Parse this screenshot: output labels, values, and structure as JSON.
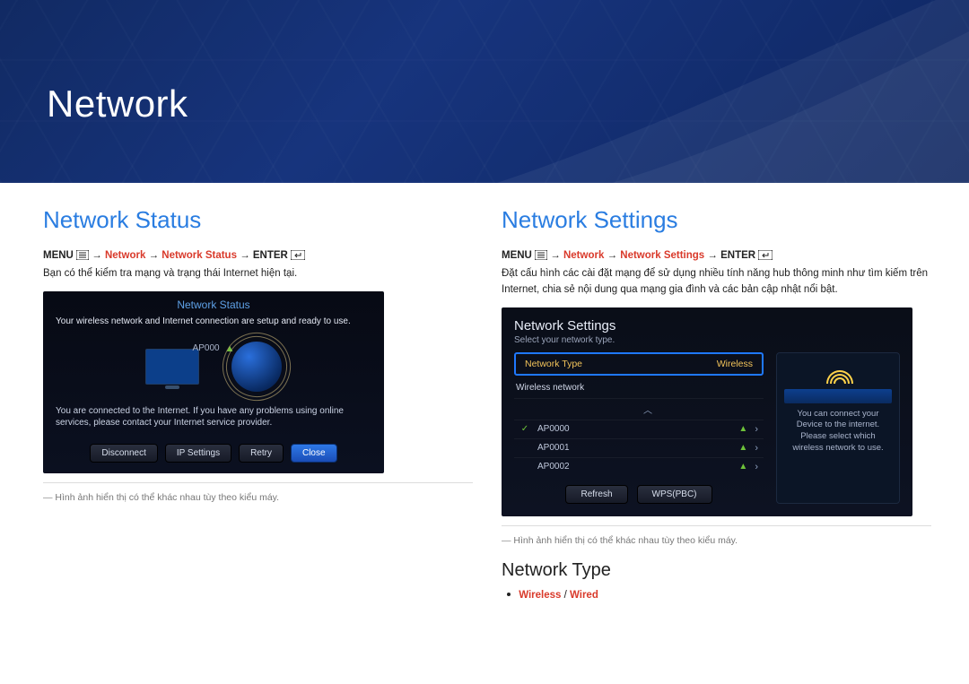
{
  "header": {
    "title": "Network"
  },
  "left": {
    "heading": "Network Status",
    "nav": {
      "menu": "MENU",
      "arrow": "→",
      "seg1": "Network",
      "seg2": "Network Status",
      "enter": "ENTER"
    },
    "desc": "Bạn có thể kiểm tra mạng và trạng thái Internet hiện tại.",
    "shot": {
      "title": "Network Status",
      "subtitle": "Your wireless network and Internet connection are setup and ready to use.",
      "ap": "AP000",
      "msg": "You are connected to the Internet. If you have any problems using online services, please contact your Internet service provider.",
      "btn_disconnect": "Disconnect",
      "btn_ip": "IP Settings",
      "btn_retry": "Retry",
      "btn_close": "Close"
    },
    "caption": "Hình ảnh hiển thị có thể khác nhau tùy theo kiểu máy."
  },
  "right": {
    "heading": "Network Settings",
    "nav": {
      "menu": "MENU",
      "seg1": "Network",
      "seg2": "Network Settings",
      "enter": "ENTER"
    },
    "desc": "Đặt cấu hình các cài đặt mạng để sử dụng nhiều tính năng hub thông minh như tìm kiếm trên Internet, chia sẻ nội dung qua mạng gia đình và các bản cập nhật nổi bật.",
    "shot": {
      "title": "Network Settings",
      "subtitle": "Select your network type.",
      "nt_key": "Network Type",
      "nt_val": "Wireless",
      "wnet": "Wireless network",
      "aps": [
        {
          "name": "AP0000",
          "checked": true
        },
        {
          "name": "AP0001",
          "checked": false
        },
        {
          "name": "AP0002",
          "checked": false
        }
      ],
      "btn_refresh": "Refresh",
      "btn_wps": "WPS(PBC)",
      "side_msg": "You can connect your Device to the internet. Please select which wireless network to use."
    },
    "caption": "Hình ảnh hiển thị có thể khác nhau tùy theo kiểu máy.",
    "ntype": {
      "heading": "Network Type",
      "opt_wireless": "Wireless",
      "sep": " / ",
      "opt_wired": "Wired"
    }
  }
}
